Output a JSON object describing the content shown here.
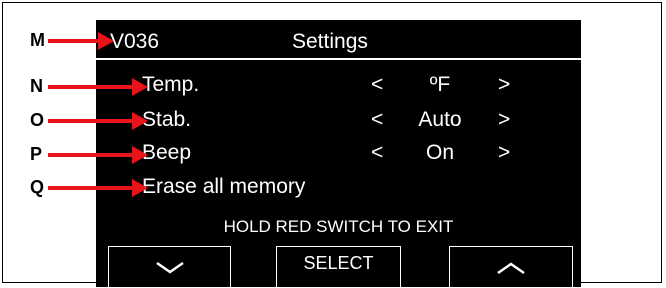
{
  "header": {
    "version": "V036",
    "title": "Settings"
  },
  "menu": [
    {
      "label": "Temp.",
      "prev": "<",
      "value": "ºF",
      "next": ">"
    },
    {
      "label": "Stab.",
      "prev": "<",
      "value": "Auto",
      "next": ">"
    },
    {
      "label": "Beep",
      "prev": "<",
      "value": "On",
      "next": ">"
    },
    {
      "label": "Erase all memory"
    }
  ],
  "hint": "HOLD RED SWITCH TO EXIT",
  "buttons": {
    "down_icon": "chevron-down-icon",
    "select": "SELECT",
    "up_icon": "chevron-up-icon"
  },
  "callouts": [
    "M",
    "N",
    "O",
    "P",
    "Q"
  ],
  "colors": {
    "screen": "#000000",
    "text": "#ffffff",
    "arrow": "#e8141b"
  }
}
